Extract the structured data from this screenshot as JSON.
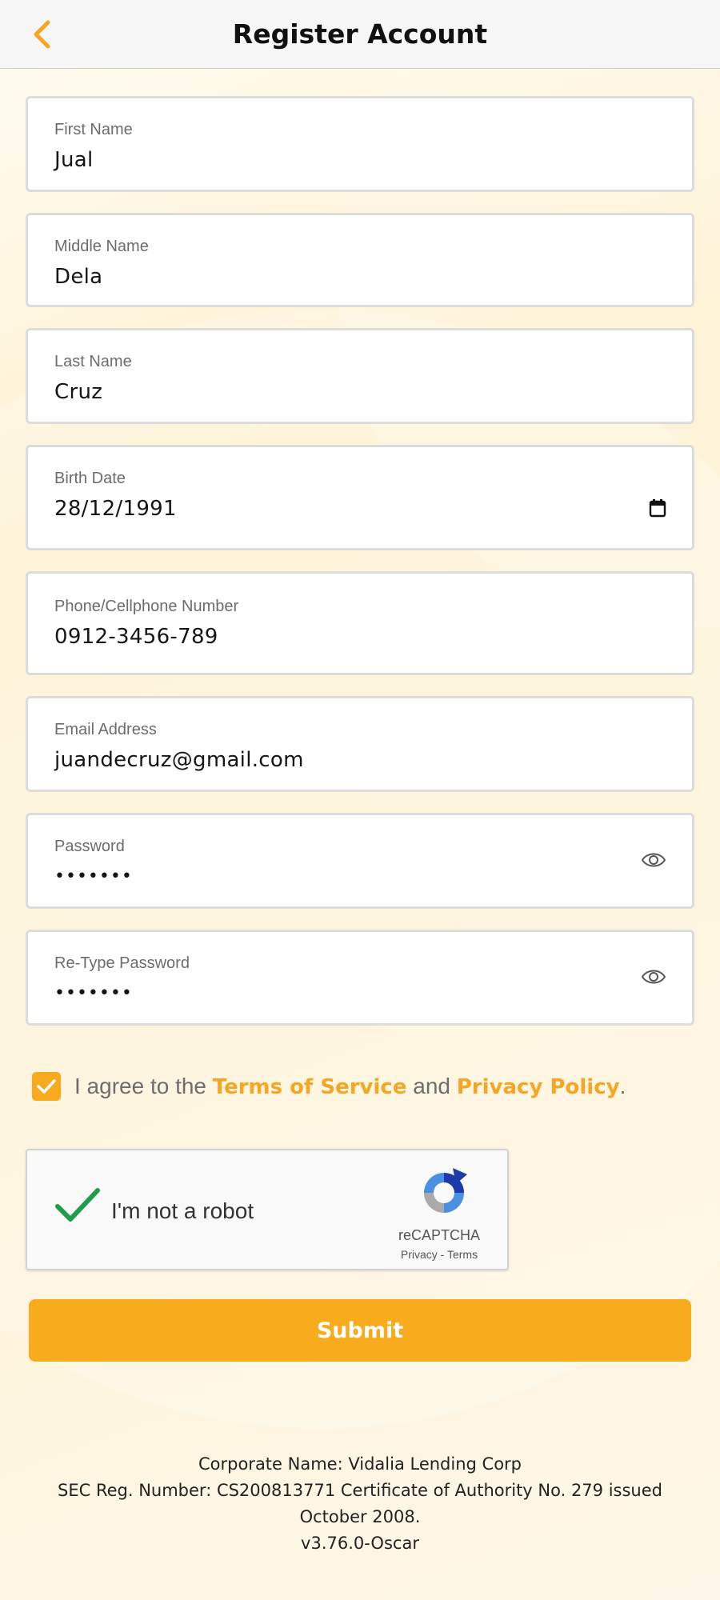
{
  "header": {
    "title": "Register Account",
    "back_icon": "chevron-left-icon"
  },
  "colors": {
    "accent": "#f7ab1d",
    "link": "#f5a623",
    "check_green": "#1e9e4a"
  },
  "fields": {
    "first_name": {
      "label": "First Name",
      "value": "Jual"
    },
    "middle_name": {
      "label": "Middle Name",
      "value": "Dela"
    },
    "last_name": {
      "label": "Last Name",
      "value": "Cruz"
    },
    "birth_date": {
      "label": "Birth Date",
      "value": "28/12/1991",
      "icon": "calendar-icon"
    },
    "phone": {
      "label": "Phone/Cellphone Number",
      "value": "0912-3456-789"
    },
    "email": {
      "label": "Email Address",
      "value": "juandecruz@gmail.com"
    },
    "password": {
      "label": "Password",
      "value": "•••••••",
      "icon": "eye-icon"
    },
    "retype_password": {
      "label": "Re-Type Password",
      "value": "•••••••",
      "icon": "eye-icon"
    }
  },
  "agree": {
    "checked": true,
    "prefix": "I agree to the",
    "terms": "Terms of Service",
    "and": "and",
    "privacy": "Privacy Policy",
    "suffix": "."
  },
  "recaptcha": {
    "checked": true,
    "label": "I'm not a robot",
    "brand": "reCAPTCHA",
    "privacy": "Privacy",
    "separator": "-",
    "terms": "Terms"
  },
  "submit_label": "Submit",
  "footer": {
    "line1": "Corporate Name: Vidalia Lending Corp",
    "line2": "SEC Reg. Number: CS200813771 Certificate of Authority No. 279 issued",
    "line3": "October 2008.",
    "version": "v3.76.0-Oscar"
  }
}
